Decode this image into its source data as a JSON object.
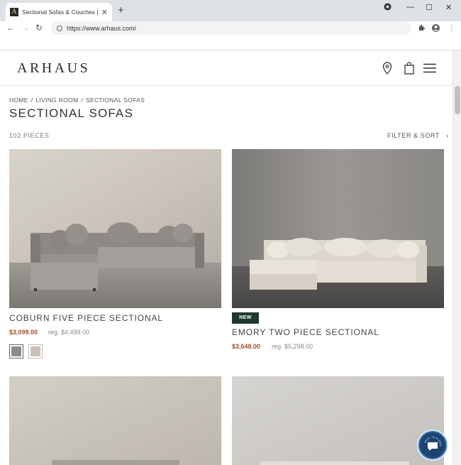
{
  "browser": {
    "tab_title": "Sectional Sofas & Couches | Lea",
    "favicon_letter": "A",
    "url": "https://www.arhaus.com/",
    "icons": [
      "close-icon",
      "new-tab-icon",
      "back-icon",
      "forward-icon",
      "reload-icon",
      "site-info-icon",
      "extensions-icon",
      "profile-icon",
      "more-icon",
      "minimize-icon",
      "maximize-icon",
      "window-close-icon"
    ]
  },
  "site": {
    "logo": "ARHAUS",
    "header_icons": [
      "location-pin-icon",
      "shopping-bag-icon",
      "hamburger-menu-icon"
    ]
  },
  "breadcrumb": [
    "HOME",
    "LIVING ROOM",
    "SECTIONAL SOFAS"
  ],
  "breadcrumb_sep": "/",
  "page": {
    "title": "SECTIONAL SOFAS",
    "count": "102 PIECES",
    "filter_label": "FILTER & SORT"
  },
  "products": [
    {
      "name": "COBURN FIVE PIECE SECTIONAL",
      "sale_price": "$3,099.00",
      "regular_price": "reg. $4,499.00",
      "swatches": [
        "#8e8b88",
        "#c9c1b8"
      ]
    },
    {
      "badge": "NEW",
      "name": "EMORY TWO PIECE SECTIONAL",
      "sale_price": "$3,648.00",
      "regular_price": "reg. $5,298.00"
    }
  ],
  "chat": {
    "label": "TALK TO A DESIGNER"
  },
  "colors": {
    "sale": "#a0522d",
    "badge": "#1f3a2c",
    "chat": "#1d4470"
  }
}
